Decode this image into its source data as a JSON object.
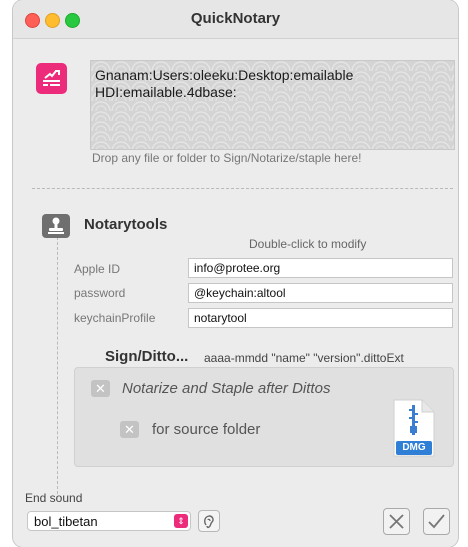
{
  "window": {
    "title": "QuickNotary"
  },
  "drop": {
    "path_line1": "Gnanam:Users:oleeku:Desktop:emailable",
    "path_line2": "HDI:emailable.4dbase:",
    "hint": "Drop any file or folder to Sign/Notarize/staple here!"
  },
  "notarytools": {
    "title": "Notarytools",
    "hint": "Double-click to modify",
    "fields": [
      {
        "label": "Apple ID",
        "value": "info@protee.org"
      },
      {
        "label": "password",
        "value": "@keychain:altool"
      },
      {
        "label": "keychainProfile",
        "value": "notarytool"
      }
    ]
  },
  "sign_ditto": {
    "title": "Sign/Ditto...",
    "format": "aaaa-mmdd \"name\" \"version\".dittoExt",
    "notarize_label": "Notarize and Staple after Dittos",
    "source_folder_label": "for source folder",
    "dmg_label": "DMG"
  },
  "end_sound": {
    "label": "End sound",
    "selected": "bol_tibetan"
  },
  "icons": {
    "app": "signature-icon",
    "notarytools": "stamp-icon",
    "dmg": "dmg-file-icon",
    "listen": "ear-icon",
    "cancel": "x-icon",
    "ok": "checkmark-icon"
  },
  "colors": {
    "accent": "#ec2b7a",
    "dmg_badge": "#2f7fd6"
  }
}
